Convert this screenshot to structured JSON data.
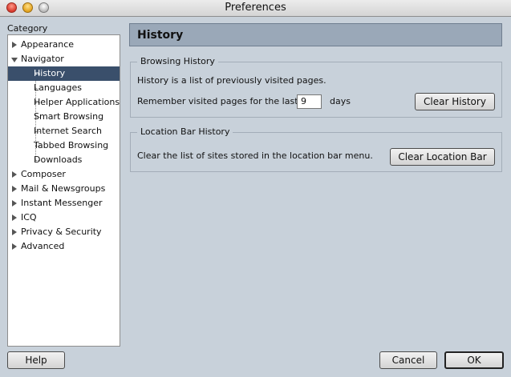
{
  "window": {
    "title": "Preferences"
  },
  "sidebar": {
    "title": "Category",
    "items": [
      {
        "label": "Appearance"
      },
      {
        "label": "Navigator"
      },
      {
        "label": "History"
      },
      {
        "label": "Languages"
      },
      {
        "label": "Helper Applications"
      },
      {
        "label": "Smart Browsing"
      },
      {
        "label": "Internet Search"
      },
      {
        "label": "Tabbed Browsing"
      },
      {
        "label": "Downloads"
      },
      {
        "label": "Composer"
      },
      {
        "label": "Mail & Newsgroups"
      },
      {
        "label": "Instant Messenger"
      },
      {
        "label": "ICQ"
      },
      {
        "label": "Privacy & Security"
      },
      {
        "label": "Advanced"
      }
    ],
    "selected": "History"
  },
  "main": {
    "heading": "History",
    "browsing": {
      "legend": "Browsing History",
      "description": "History is a list of previously visited pages.",
      "remember_prefix": "Remember visited pages for the last",
      "days_value": "9",
      "days_suffix": "days",
      "clear_button": "Clear History"
    },
    "location": {
      "legend": "Location Bar History",
      "description": "Clear the list of sites stored in the location bar menu.",
      "clear_button": "Clear Location Bar"
    }
  },
  "footer": {
    "help": "Help",
    "cancel": "Cancel",
    "ok": "OK"
  }
}
